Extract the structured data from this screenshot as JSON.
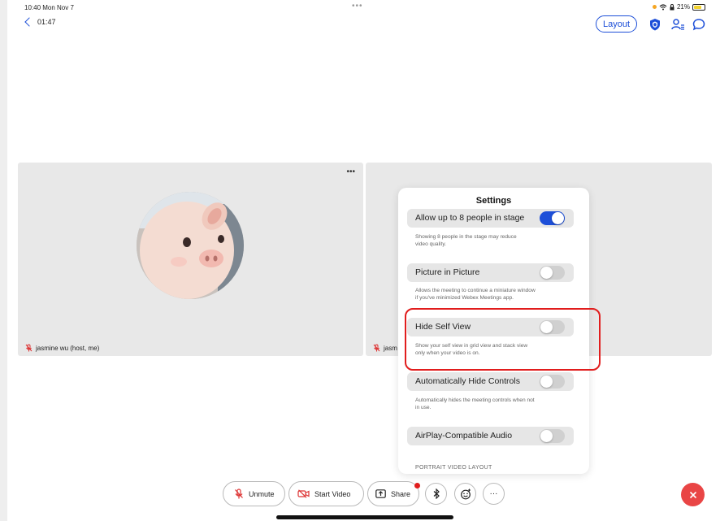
{
  "status_bar": {
    "time": "10:40  Mon Nov 7",
    "dots": "•••",
    "battery": "21%"
  },
  "top_bar": {
    "elapsed": "01:47",
    "layout_label": "Layout"
  },
  "participants": [
    {
      "name": "jasmine wu (host, me)",
      "more": "•••"
    },
    {
      "name": "jasm"
    }
  ],
  "settings": {
    "title": "Settings",
    "items": [
      {
        "label": "Allow up to 8 people in stage",
        "on": true,
        "description": [
          "Showing 8 people in the stage may reduce",
          "video quality."
        ]
      },
      {
        "label": "Picture in Picture",
        "on": false,
        "description": [
          "Allows the meeting to continue a miniature window",
          "if you've minimized Webex Meetings app."
        ]
      },
      {
        "label": "Hide Self View",
        "on": false,
        "description": [
          "Show your self view in grid view and stack view",
          "only when your video is on."
        ]
      },
      {
        "label": "Automatically Hide Controls",
        "on": false,
        "description": [
          "Automatically hides the meeting controls when not",
          "in use."
        ]
      },
      {
        "label": "AirPlay-Compatible Audio",
        "on": false,
        "description": []
      }
    ],
    "section_header": "PORTRAIT VIDEO LAYOUT"
  },
  "controls": {
    "unmute": "Unmute",
    "start_video": "Start Video",
    "share": "Share",
    "more": "···"
  },
  "colors": {
    "accent": "#1d4fd8",
    "danger": "#e11d1d",
    "end_call": "#e94545",
    "battery": "#f2d22b"
  }
}
